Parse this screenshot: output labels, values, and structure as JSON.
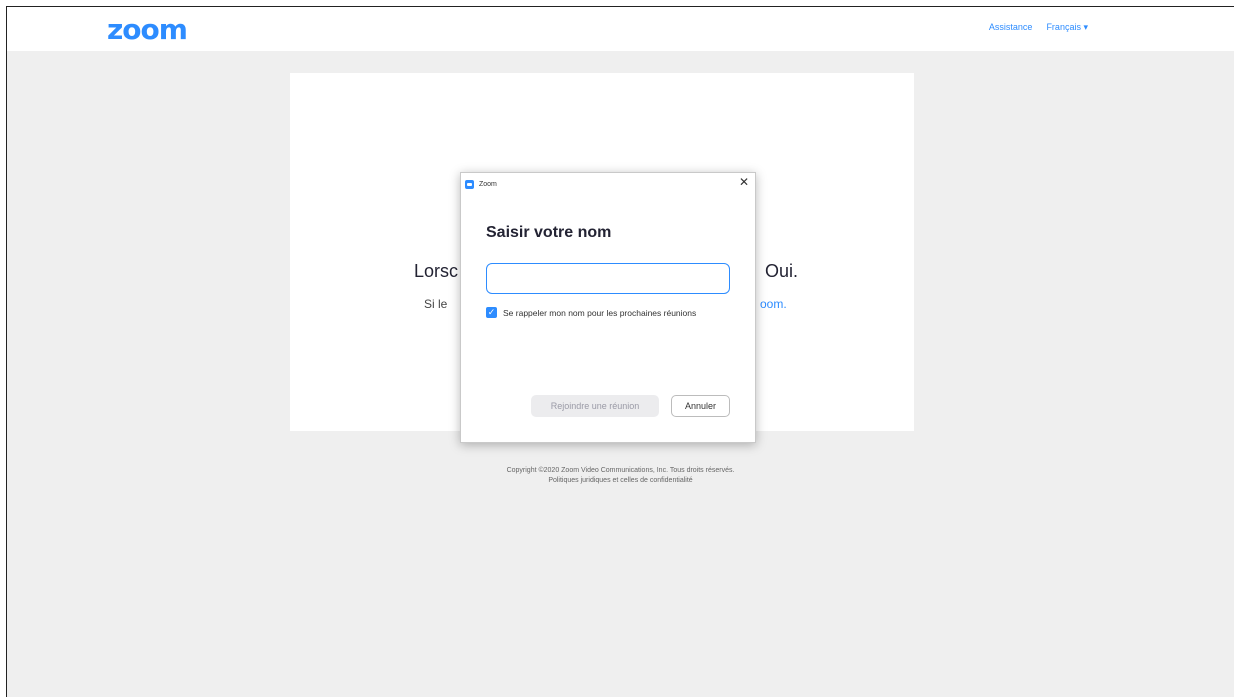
{
  "header": {
    "logo": "zoom",
    "links": [
      "Assistance",
      "Français"
    ]
  },
  "background": {
    "heading_left": "Lorsc",
    "heading_right": "Oui.",
    "sub_left": "Si le",
    "sub_right": "oom."
  },
  "footer": {
    "line1": "Copyright ©2020 Zoom Video Communications, Inc. Tous droits réservés.",
    "line2": "Politiques juridiques et celles de confidentialité"
  },
  "dialog": {
    "window_title": "Zoom",
    "heading": "Saisir votre nom",
    "name_value": "",
    "remember_label": "Se rappeler mon nom pour les prochaines réunions",
    "remember_checked": true,
    "join_label": "Rejoindre une réunion",
    "cancel_label": "Annuler"
  },
  "colors": {
    "accent": "#2d8cff",
    "page_bg": "#efefef"
  }
}
